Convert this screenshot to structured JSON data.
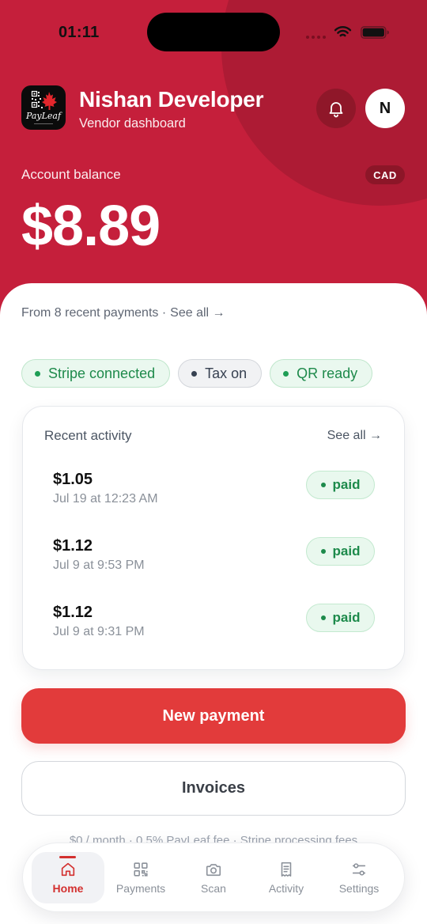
{
  "status_bar": {
    "time": "01:11"
  },
  "header": {
    "logo_text": "PayLeaf",
    "title": "Nishan Developer",
    "subtitle": "Vendor dashboard",
    "avatar_initial": "N",
    "notification_icon": "bell-icon"
  },
  "balance": {
    "label": "Account balance",
    "currency": "CAD",
    "amount": "$8.89",
    "summary": "From 8 recent payments ·",
    "summary_link": "See all →"
  },
  "chips": [
    {
      "label": "Stripe connected",
      "text_color": "#1E8A4B",
      "bg": "#EAF8EF",
      "border": "#BFE6CB",
      "dot_color": "#1E9E55"
    },
    {
      "label": "Tax on",
      "text_color": "#374151",
      "bg": "#F1F2F4",
      "border": "#D3D6DB",
      "dot_color": "#374151"
    },
    {
      "label": "QR ready",
      "text_color": "#1E8A4B",
      "bg": "#EAF8EF",
      "border": "#BFE6CB",
      "dot_color": "#1E9E55"
    }
  ],
  "activity": {
    "title": "Recent activity",
    "see_all": "See all →",
    "items": [
      {
        "amount": "$1.05",
        "date": "Jul 19 at 12:23 AM",
        "status": "paid"
      },
      {
        "amount": "$1.12",
        "date": "Jul 9 at 9:53 PM",
        "status": "paid"
      },
      {
        "amount": "$1.12",
        "date": "Jul 9 at 9:31 PM",
        "status": "paid"
      }
    ]
  },
  "actions": {
    "new_payment": "New payment",
    "invoices": "Invoices"
  },
  "footer_note": "$0 / month · 0.5% PayLeaf fee · Stripe processing fees",
  "nav": {
    "items": [
      {
        "label": "Home",
        "icon": "home-icon",
        "active": true
      },
      {
        "label": "Payments",
        "icon": "qr-code-icon",
        "active": false
      },
      {
        "label": "Scan",
        "icon": "camera-icon",
        "active": false
      },
      {
        "label": "Activity",
        "icon": "receipt-icon",
        "active": false
      },
      {
        "label": "Settings",
        "icon": "sliders-icon",
        "active": false
      }
    ]
  },
  "colors": {
    "header_bg": "#C51F3B",
    "header_circle": "#AD1B34",
    "primary_button": "#E23B3B",
    "accent_red": "#D3302F",
    "paid_text": "#1D8A4B",
    "paid_bg": "#E9F8EE",
    "paid_border": "#C3E9CF"
  }
}
